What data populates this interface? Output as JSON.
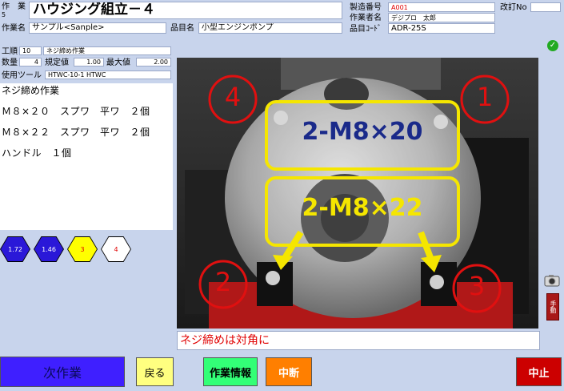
{
  "header": {
    "operation_label": "作　業",
    "operation_no": "5",
    "title": "ハウジング組立－４",
    "work_name_label": "作業名",
    "work_name": "サンプル<Sanple>",
    "product_name_label": "品目名",
    "product_name": "小型エンジンポンプ",
    "mfg_no_label": "製造番号",
    "mfg_no": "A001",
    "worker_label": "作業者名",
    "worker": "デジプロ　太郎",
    "product_code_label": "品目ｺｰﾄﾞ",
    "product_code": "ADR-25S",
    "revision_label": "改訂No",
    "revision": ""
  },
  "tool_info": {
    "process_label": "工順",
    "process_no": "10",
    "process_name": "ネジ締め作業",
    "qty_label": "数量",
    "qty": "4",
    "spec_label": "規定値",
    "spec": "1.00",
    "max_label": "最大値",
    "max": "2.00",
    "tool_label": "使用ツール",
    "tool": "HTWC-10-1 HTWC"
  },
  "steps": {
    "heading": "ネジ締め作業",
    "lines": [
      "Ｍ８×２０　スプワ　平ワ　２個",
      "Ｍ８×２２　スプワ　平ワ　２個",
      "ハンドル　１個"
    ]
  },
  "badges": [
    {
      "label": "1.72",
      "bg": "#2a18d8",
      "fg": "#ffffff"
    },
    {
      "label": "1.46",
      "bg": "#2a18d8",
      "fg": "#ffffff"
    },
    {
      "label": "3",
      "bg": "#ffff00",
      "fg": "#e00000"
    },
    {
      "label": "4",
      "bg": "#ffffff",
      "fg": "#e00000"
    }
  ],
  "photo": {
    "callout_top": "2-M8×20",
    "callout_bottom": "2-M8×22",
    "circle_1": "1",
    "circle_2": "2",
    "circle_3": "3",
    "circle_4": "4"
  },
  "message": "ネジ締めは対角に",
  "buttons": {
    "next": "次作業",
    "back": "戻る",
    "info": "作業情報",
    "pause": "中断",
    "stop": "中止",
    "manual": "手動"
  },
  "colors": {
    "background": "#c8d4ec",
    "callout_border": "#f5e600",
    "callout_text_top": "#1a2a8a",
    "callout_text_bottom": "#f5e600",
    "circle_red": "#e01010"
  }
}
